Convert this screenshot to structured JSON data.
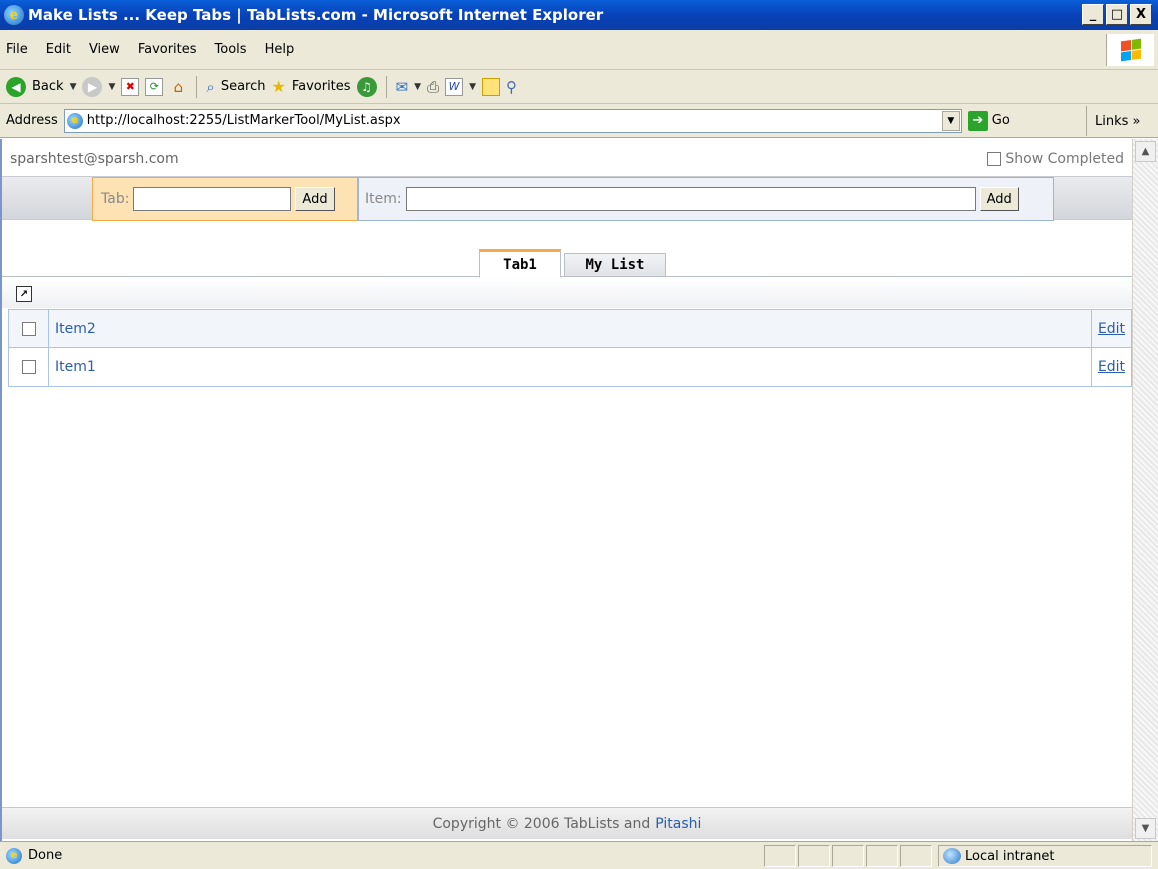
{
  "window": {
    "title": "Make Lists ... Keep Tabs | TabLists.com - Microsoft Internet Explorer",
    "minimize": "_",
    "maximize": "□",
    "close": "X"
  },
  "menu": [
    "File",
    "Edit",
    "View",
    "Favorites",
    "Tools",
    "Help"
  ],
  "toolbar": {
    "back": "Back",
    "search": "Search",
    "favorites": "Favorites"
  },
  "address": {
    "label": "Address",
    "url": "http://localhost:2255/ListMarkerTool/MyList.aspx",
    "go": "Go",
    "links": "Links »"
  },
  "page": {
    "user": "sparshtest@sparsh.com",
    "show_completed": "Show Completed",
    "tab_label": "Tab:",
    "tab_add": "Add",
    "item_label": "Item:",
    "item_add": "Add",
    "tabs": [
      {
        "label": "Tab1",
        "active": true
      },
      {
        "label": "My List",
        "active": false
      }
    ],
    "items": [
      {
        "label": "Item2",
        "edit": "Edit"
      },
      {
        "label": "Item1",
        "edit": "Edit"
      }
    ],
    "footer": {
      "text": "Copyright © 2006 TabLists and",
      "link": "Pitashi"
    }
  },
  "status": {
    "text": "Done",
    "zone": "Local intranet"
  }
}
